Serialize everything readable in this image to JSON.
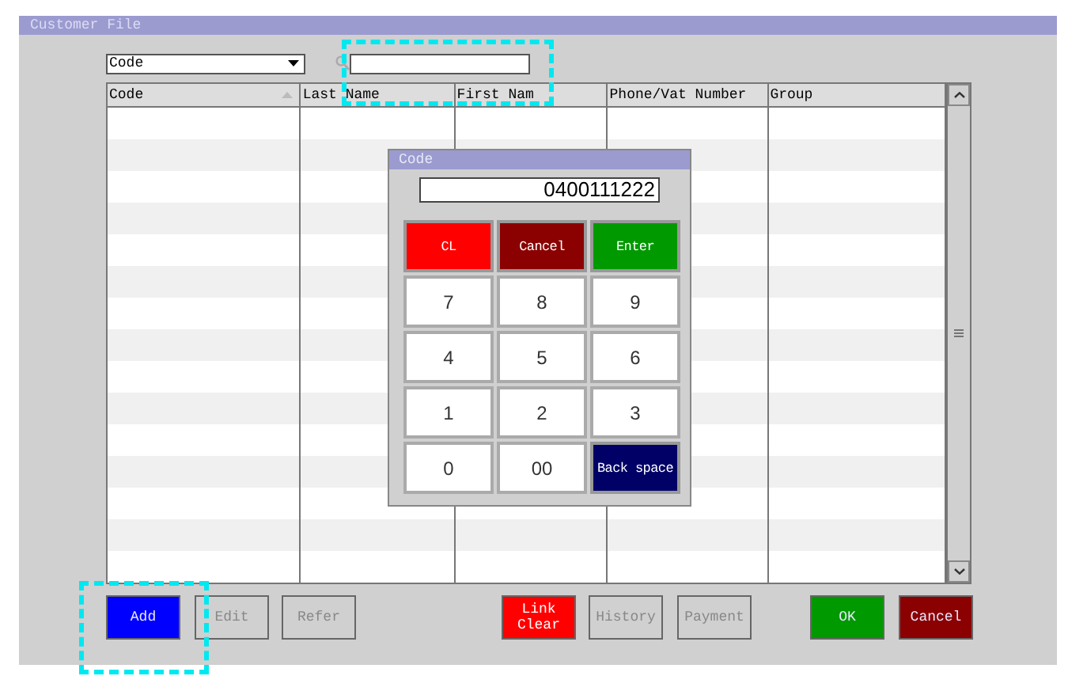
{
  "window": {
    "title": "Customer File"
  },
  "filter": {
    "value": "Code"
  },
  "table": {
    "columns": [
      {
        "label": "Code",
        "sorted": true
      },
      {
        "label": "Last Name",
        "sorted": false
      },
      {
        "label": "First Nam",
        "sorted": false
      },
      {
        "label": "Phone/Vat Number",
        "sorted": false
      },
      {
        "label": "Group",
        "sorted": false
      }
    ]
  },
  "dialog": {
    "title": "Code",
    "display": "0400111222",
    "keys": [
      {
        "label": "CL",
        "color": "#ff0000"
      },
      {
        "label": "Cancel",
        "color": "#8b0000"
      },
      {
        "label": "Enter",
        "color": "#009900"
      },
      {
        "label": "7"
      },
      {
        "label": "8"
      },
      {
        "label": "9"
      },
      {
        "label": "4"
      },
      {
        "label": "5"
      },
      {
        "label": "6"
      },
      {
        "label": "1"
      },
      {
        "label": "2"
      },
      {
        "label": "3"
      },
      {
        "label": "0"
      },
      {
        "label": "00"
      },
      {
        "label": "Back space",
        "color": "#000066"
      }
    ]
  },
  "buttons": [
    {
      "label": "Add",
      "color": "#0000ff",
      "disabled": false
    },
    {
      "label": "Edit",
      "disabled": true
    },
    {
      "label": "Refer",
      "disabled": true
    },
    {
      "label": "Link Clear",
      "color": "#ff0000",
      "disabled": false
    },
    {
      "label": "History",
      "disabled": true
    },
    {
      "label": "Payment",
      "disabled": true
    },
    {
      "label": "OK",
      "color": "#009900",
      "disabled": false
    },
    {
      "label": "Cancel",
      "color": "#8b0000",
      "disabled": false
    }
  ]
}
